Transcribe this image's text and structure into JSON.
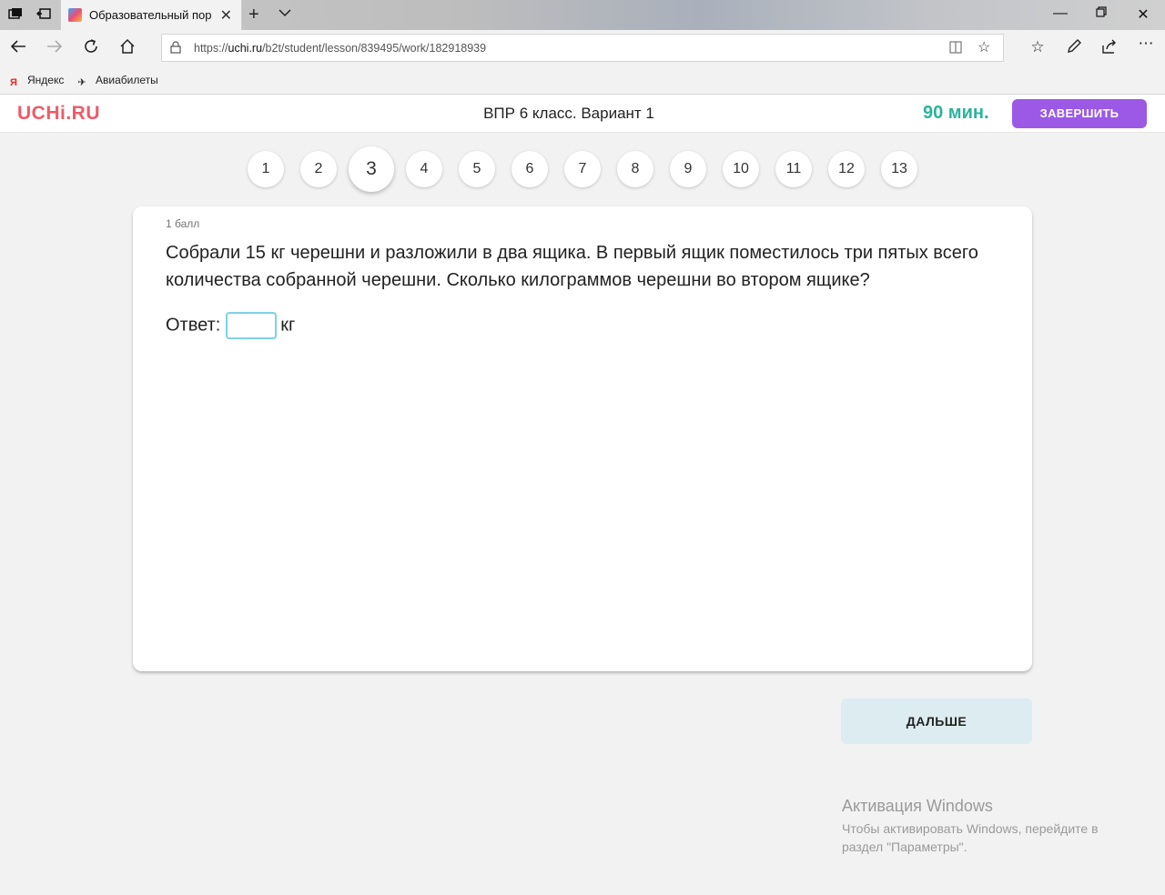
{
  "browser": {
    "tab_title": "Образовательный пор",
    "url_prefix": "https://",
    "url_host": "uchi.ru",
    "url_path": "/b2t/student/lesson/839495/work/182918939",
    "favorites": [
      {
        "label": "Яндекс",
        "icon": "yandex-icon"
      },
      {
        "label": "Авиабилеты",
        "icon": "airplane-icon"
      }
    ]
  },
  "header": {
    "logo": "UCHi.RU",
    "title": "ВПР 6 класс. Вариант 1",
    "timer": "90 мин.",
    "finish_label": "ЗАВЕРШИТЬ"
  },
  "questions": [
    "1",
    "2",
    "3",
    "4",
    "5",
    "6",
    "7",
    "8",
    "9",
    "10",
    "11",
    "12",
    "13"
  ],
  "active_question": "3",
  "task": {
    "points": "1 балл",
    "text": "Собрали 15 кг черешни и разложили в два ящика. В первый ящик поместилось три пятых всего количества собранной черешни. Сколько килограммов черешни во втором ящике?",
    "answer_label": "Ответ:",
    "answer_value": "",
    "unit": "кг"
  },
  "next_label": "ДАЛЬШЕ",
  "watermark": {
    "title": "Активация Windows",
    "subtitle": "Чтобы активировать Windows, перейдите в раздел \"Параметры\"."
  },
  "colors": {
    "logo": "#ef5a6a",
    "timer": "#2bb39c",
    "finish_button": "#9b59e6",
    "next_button": "#dcecf1",
    "input_border": "#7fd0e6"
  }
}
